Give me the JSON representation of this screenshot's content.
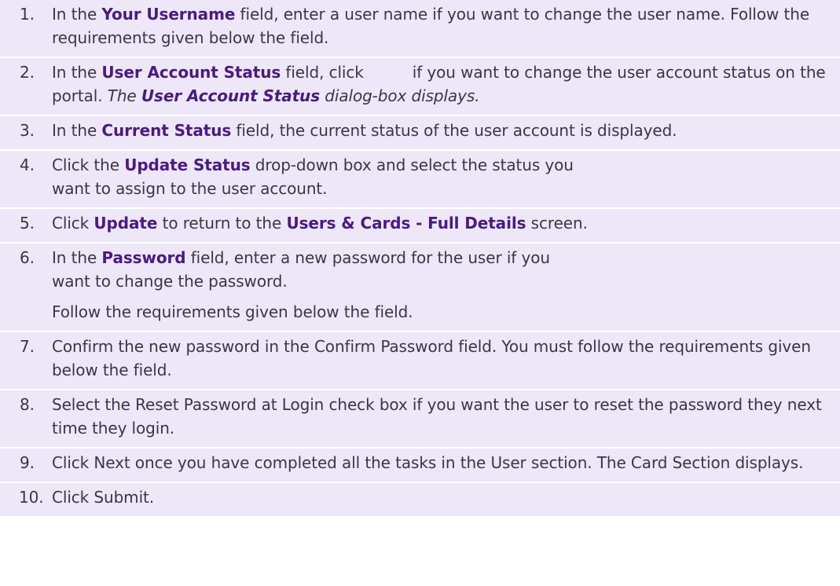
{
  "steps": [
    {
      "num": "1.",
      "p1": "In the ",
      "kw1": "Your Username",
      "p2": " field, enter a user name if you want to change the user name. Follow the requirements given below the field."
    },
    {
      "num": "2.",
      "p1": "In the ",
      "kw1": "User Account Status",
      "p2": " field, click",
      "icon": "edit-icon",
      "p3": "if you want to change the user account status on the portal. ",
      "em1": "The ",
      "em_kw": "User Account Status",
      "em2": " dialog-box displays."
    },
    {
      "num": "3.",
      "p1": "In the ",
      "kw1": "Current Status",
      "p2": " field, the current status of the user account is displayed."
    },
    {
      "num": "4.",
      "p1": "Click the ",
      "kw1": "Update Status",
      "p2": " drop-down box and select the status you want to assign to the user account."
    },
    {
      "num": "5.",
      "p1": "Click ",
      "kw1": "Update",
      "p2": " to return to the ",
      "kw2": "Users & Cards - Full Details",
      "p3": " screen."
    },
    {
      "num": "6.",
      "p1": "In the ",
      "kw1": "Password",
      "p2": " field, enter a new password for the user if you want to change the password.",
      "sub": "Follow the requirements given below the field."
    },
    {
      "num": "7.",
      "text": "Confirm the new password in the Confirm Password field. You must follow the requirements given below the field."
    },
    {
      "num": "8.",
      "text": "Select the Reset Password at Login check box if you want the user to reset the password they next time they login."
    },
    {
      "num": "9.",
      "text": "Click Next once you have completed all the tasks in the User section. The Card Section displays."
    },
    {
      "num": "10.",
      "text": "Click Submit."
    }
  ]
}
